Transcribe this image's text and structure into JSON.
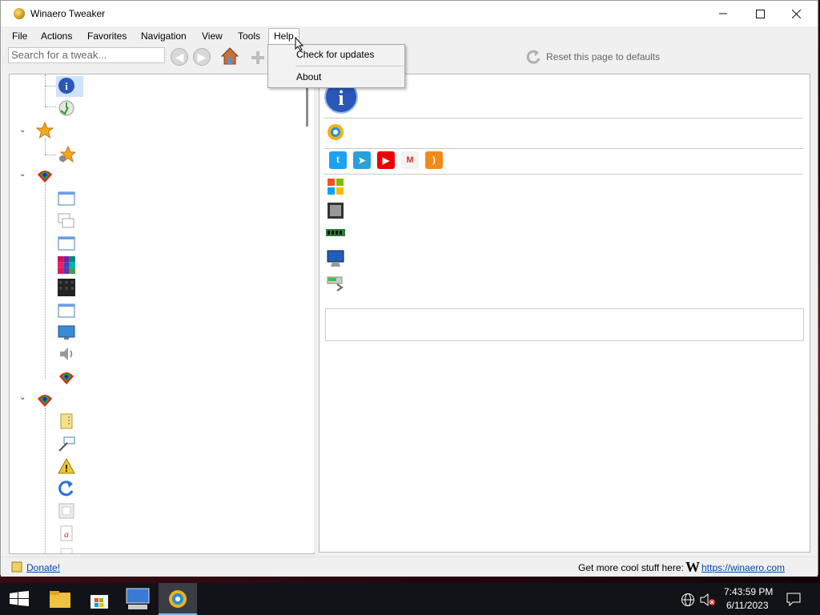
{
  "window": {
    "title": "Winaero Tweaker"
  },
  "menubar": {
    "items": [
      "File",
      "Actions",
      "Favorites",
      "Navigation",
      "View",
      "Tools",
      "Help"
    ],
    "active": "Help"
  },
  "help_menu": {
    "items": [
      "Check for updates",
      "About"
    ]
  },
  "toolbar": {
    "search_placeholder": "Search for a tweak...",
    "reset_label": "Reset this page to defaults"
  },
  "tree": {
    "icons": [
      "info-icon",
      "clock-icon",
      "star-icon",
      "star-gear-icon",
      "paint-icon",
      "window-icon",
      "windows-stack-icon",
      "window-icon",
      "colors-icon",
      "dark-colors-icon",
      "window-icon",
      "monitor-icon",
      "speaker-icon",
      "paint-icon",
      "paint-icon",
      "notepad-icon",
      "shortcut-icon",
      "warning-icon",
      "refresh-arrow-icon",
      "frame-icon",
      "font-icon"
    ]
  },
  "right_panel": {
    "social_icons": [
      "twitter-icon",
      "telegram-icon",
      "youtube-icon",
      "gmail-icon",
      "rss-icon"
    ],
    "system_icons": [
      "windows-logo-icon",
      "cpu-icon",
      "ram-icon",
      "display-icon",
      "gpu-icon"
    ]
  },
  "statusbar": {
    "donate_label": "Donate!",
    "promo_text": "Get more cool stuff here:",
    "site_link": "https://winaero.com"
  },
  "taskbar": {
    "time": "7:43:59 PM",
    "date": "6/11/2023"
  },
  "colors": {
    "accent": "#0078d7",
    "selection": "#cfe3fb",
    "link": "#0645ad"
  }
}
